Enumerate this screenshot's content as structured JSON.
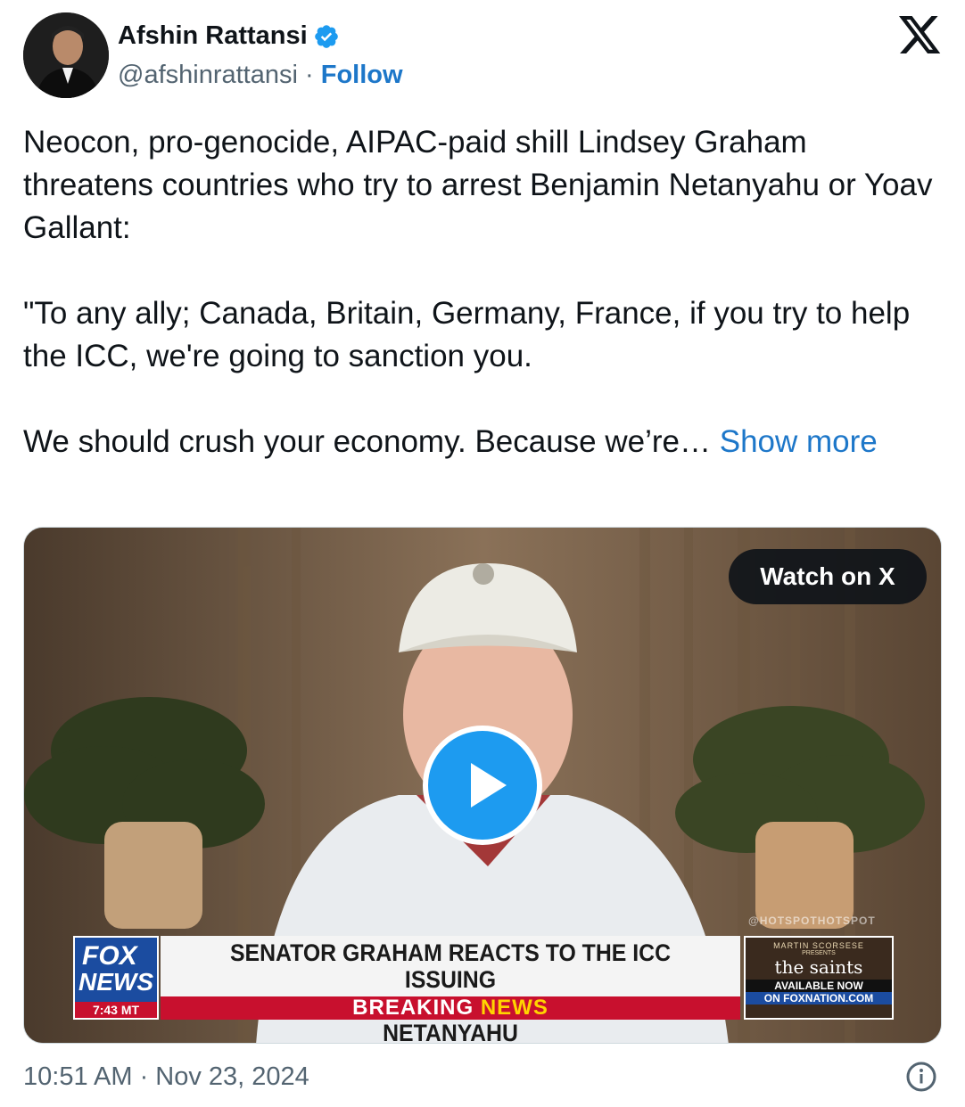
{
  "author": {
    "name": "Afshin Rattansi",
    "handle": "@afshinrattansi",
    "separator": "·",
    "follow_label": "Follow"
  },
  "tweet": {
    "paragraphs": [
      "Neocon, pro-genocide, AIPAC-paid shill Lindsey Graham threatens countries who try to arrest Benjamin Netanyahu or Yoav Gallant:",
      "\"To any ally; Canada, Britain, Germany, France, if you try to help the ICC, we're going to sanction you."
    ],
    "truncated_text": "We should crush your economy. Because we’re… ",
    "show_more_label": "Show more"
  },
  "video": {
    "watch_label": "Watch on X",
    "watermark": "@HOTSPOTHOTSPOT",
    "network": {
      "line1": "FOX",
      "line2": "NEWS",
      "time": "7:43 MT"
    },
    "headline_line1": "SENATOR GRAHAM REACTS TO THE ICC ISSUING",
    "headline_line2": "AN ARREST WARRANT FOR BENJAMIN NETANYAHU",
    "ticker_breaking": "BREAKING",
    "ticker_news": "NEWS",
    "promo": {
      "director": "MARTIN SCORSESE",
      "presents": "PRESENTS",
      "title": "the saints",
      "availability": "AVAILABLE NOW",
      "where": "ON FOXNATION.COM"
    }
  },
  "footer": {
    "timestamp": "10:51 AM · Nov 23, 2024"
  },
  "colors": {
    "link": "#1d77c9",
    "play_button": "#1d9bf0",
    "verified": "#1d9bf0",
    "fox_red": "#c8102e",
    "fox_blue": "#1b4ca0"
  },
  "icons": [
    "verified-badge-icon",
    "x-logo-icon",
    "play-icon",
    "info-icon"
  ]
}
